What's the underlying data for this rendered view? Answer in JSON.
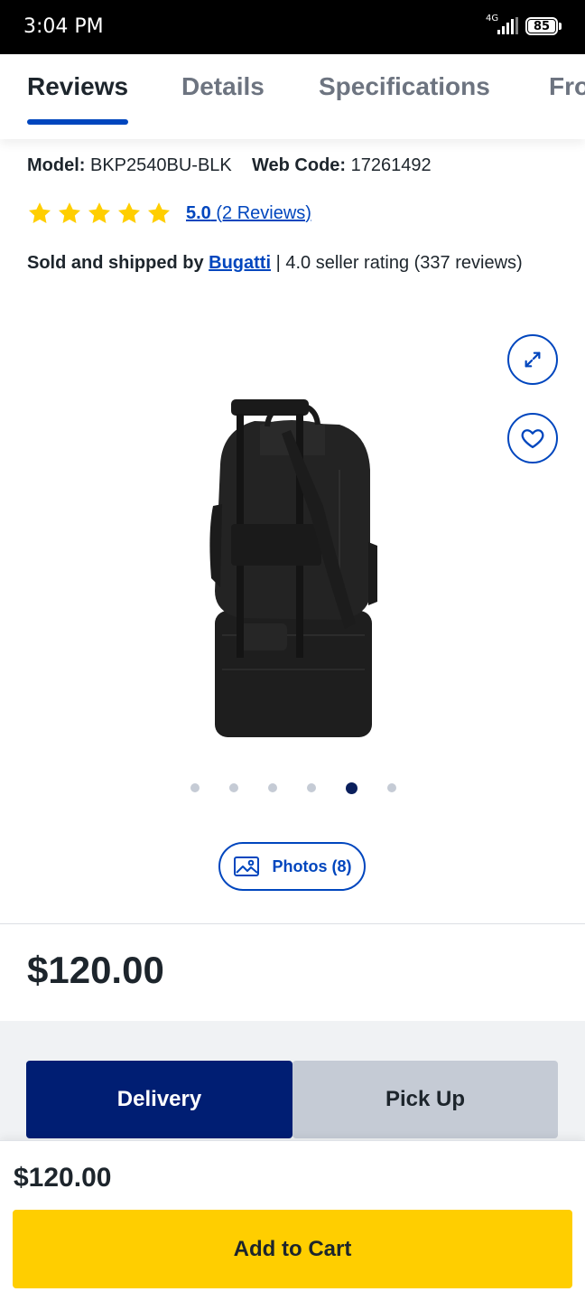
{
  "status_bar": {
    "time": "3:04 PM",
    "network": "4G",
    "battery": "85"
  },
  "tabs": [
    {
      "label": "Reviews",
      "active": true
    },
    {
      "label": "Details",
      "active": false
    },
    {
      "label": "Specifications",
      "active": false
    },
    {
      "label": "From the Manufacturer",
      "active": false
    }
  ],
  "product": {
    "model_label": "Model:",
    "model_value": "BKP2540BU-BLK",
    "webcode_label": "Web Code:",
    "webcode_value": "17261492",
    "rating_value": "5.0",
    "stars": 5,
    "reviews_link": "(2 Reviews)",
    "sold_prefix": "Sold and shipped by",
    "seller_name": "Bugatti",
    "seller_rating": "| 4.0 seller rating (337 reviews)",
    "image_count_dots": 6,
    "active_dot": 5,
    "photos_label": "Photos (8)",
    "price": "$120.00"
  },
  "fulfillment": {
    "delivery_label": "Delivery",
    "pickup_label": "Pick Up",
    "selected": "Delivery"
  },
  "sticky_bar": {
    "price": "$120.00",
    "add_to_cart_label": "Add to Cart"
  },
  "colors": {
    "brand_blue": "#0046be",
    "dark_navy": "#001e73",
    "star_yellow": "#ffce00",
    "cart_yellow": "#ffce00"
  }
}
